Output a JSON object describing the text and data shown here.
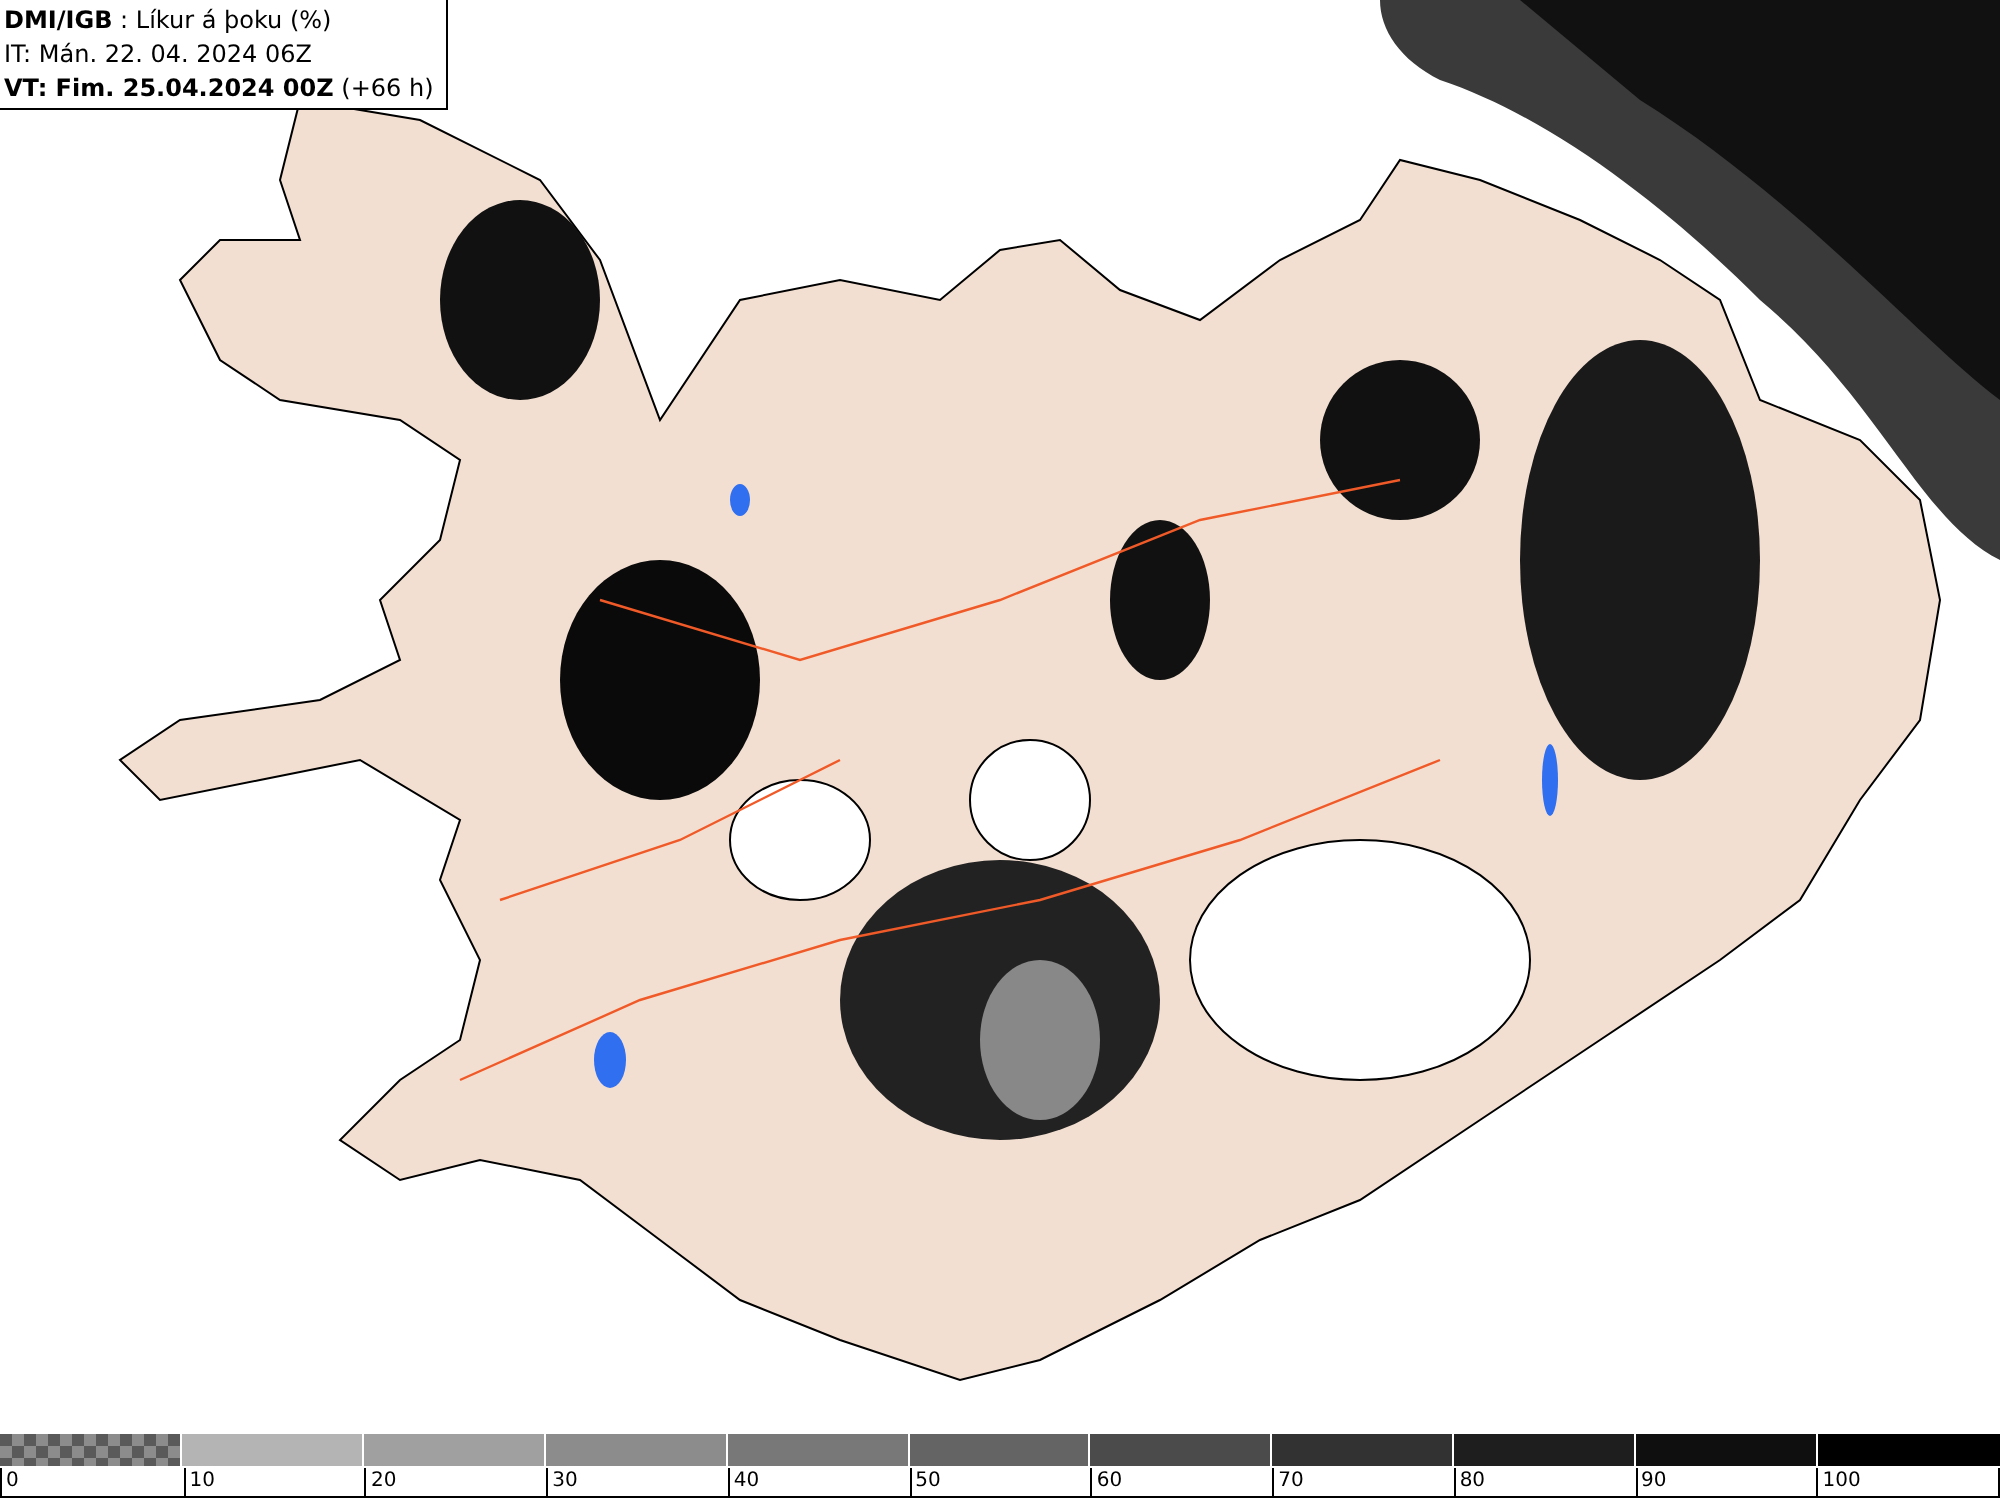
{
  "header": {
    "lines": [
      "**DMI/IGB** : Líkur á þoku (%)",
      "IT: Mán. 22. 04. 2024 06Z",
      "**VT: Fim. 25.04.2024 00Z** (+66 h)"
    ]
  },
  "legend": {
    "bins": [
      {
        "kind": "checkered",
        "color": "#8c8c8c"
      },
      {
        "kind": "solid",
        "color": "#b4b4b4"
      },
      {
        "kind": "solid",
        "color": "#a0a0a0"
      },
      {
        "kind": "solid",
        "color": "#8c8c8c"
      },
      {
        "kind": "solid",
        "color": "#787878"
      },
      {
        "kind": "solid",
        "color": "#646464"
      },
      {
        "kind": "solid",
        "color": "#4b4b4b"
      },
      {
        "kind": "solid",
        "color": "#323232"
      },
      {
        "kind": "solid",
        "color": "#1e1e1e"
      },
      {
        "kind": "solid",
        "color": "#0f0f0f"
      },
      {
        "kind": "solid",
        "color": "#000000"
      }
    ],
    "ticks": [
      "0",
      "10",
      "20",
      "30",
      "40",
      "50",
      "60",
      "70",
      "80",
      "90",
      "100"
    ]
  }
}
